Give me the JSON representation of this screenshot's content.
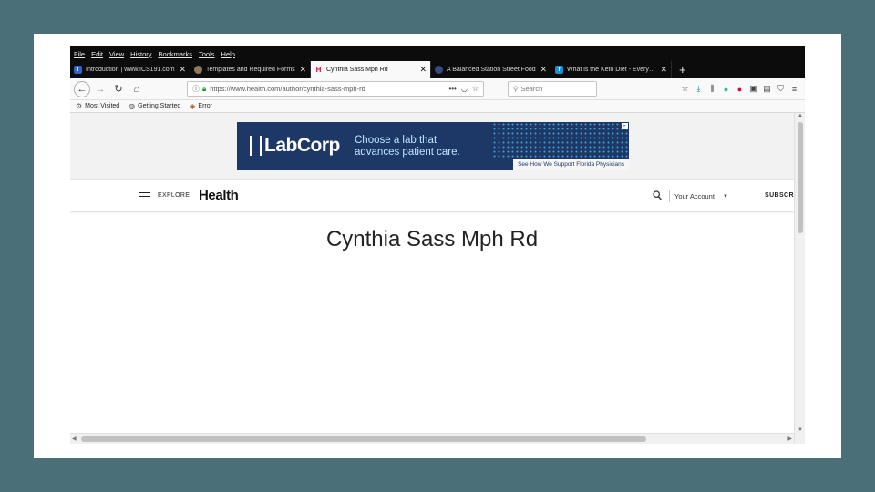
{
  "menu": [
    "File",
    "Edit",
    "View",
    "History",
    "Bookmarks",
    "Tools",
    "Help"
  ],
  "tabs": [
    {
      "title": "Introduction | www.ICS191.com",
      "favicon": "I",
      "fav_color": "#2f63c4",
      "active": false
    },
    {
      "title": "Templates and Required Forms",
      "favicon": "",
      "fav_color": "#8a7a5a",
      "active": false
    },
    {
      "title": "Cynthia Sass Mph Rd",
      "favicon": "H",
      "fav_color": "#d0103a",
      "active": true
    },
    {
      "title": "A Balanced Station Street Food",
      "favicon": "",
      "fav_color": "#334a7a",
      "active": false
    },
    {
      "title": "What is the Keto Diet - Everything",
      "favicon": "f",
      "fav_color": "#1a8fd8",
      "active": false
    }
  ],
  "navbar": {
    "url": "https://www.health.com/author/cynthia-sass-mph-rd",
    "search_placeholder": "Search"
  },
  "bookmarks": [
    {
      "label": "Most Visited",
      "icon": "gear-icon"
    },
    {
      "label": "Getting Started",
      "icon": "globe-icon"
    },
    {
      "label": "Error",
      "icon": "page-icon"
    }
  ],
  "ad": {
    "brand": "LabCorp",
    "tagline_1": "Choose a lab that",
    "tagline_2": "advances patient care.",
    "cta": "See How We Support Florida Physicians",
    "color": "#1d3866"
  },
  "site_header": {
    "explore": "EXPLORE",
    "brand": "Health",
    "account": "Your Account",
    "subscribe": "SUBSCRI"
  },
  "page": {
    "author_name": "Cynthia Sass Mph Rd"
  },
  "colors": {
    "background": "#4a6f78",
    "tabstrip": "#0c0c0d",
    "lock": "#12a01a"
  }
}
